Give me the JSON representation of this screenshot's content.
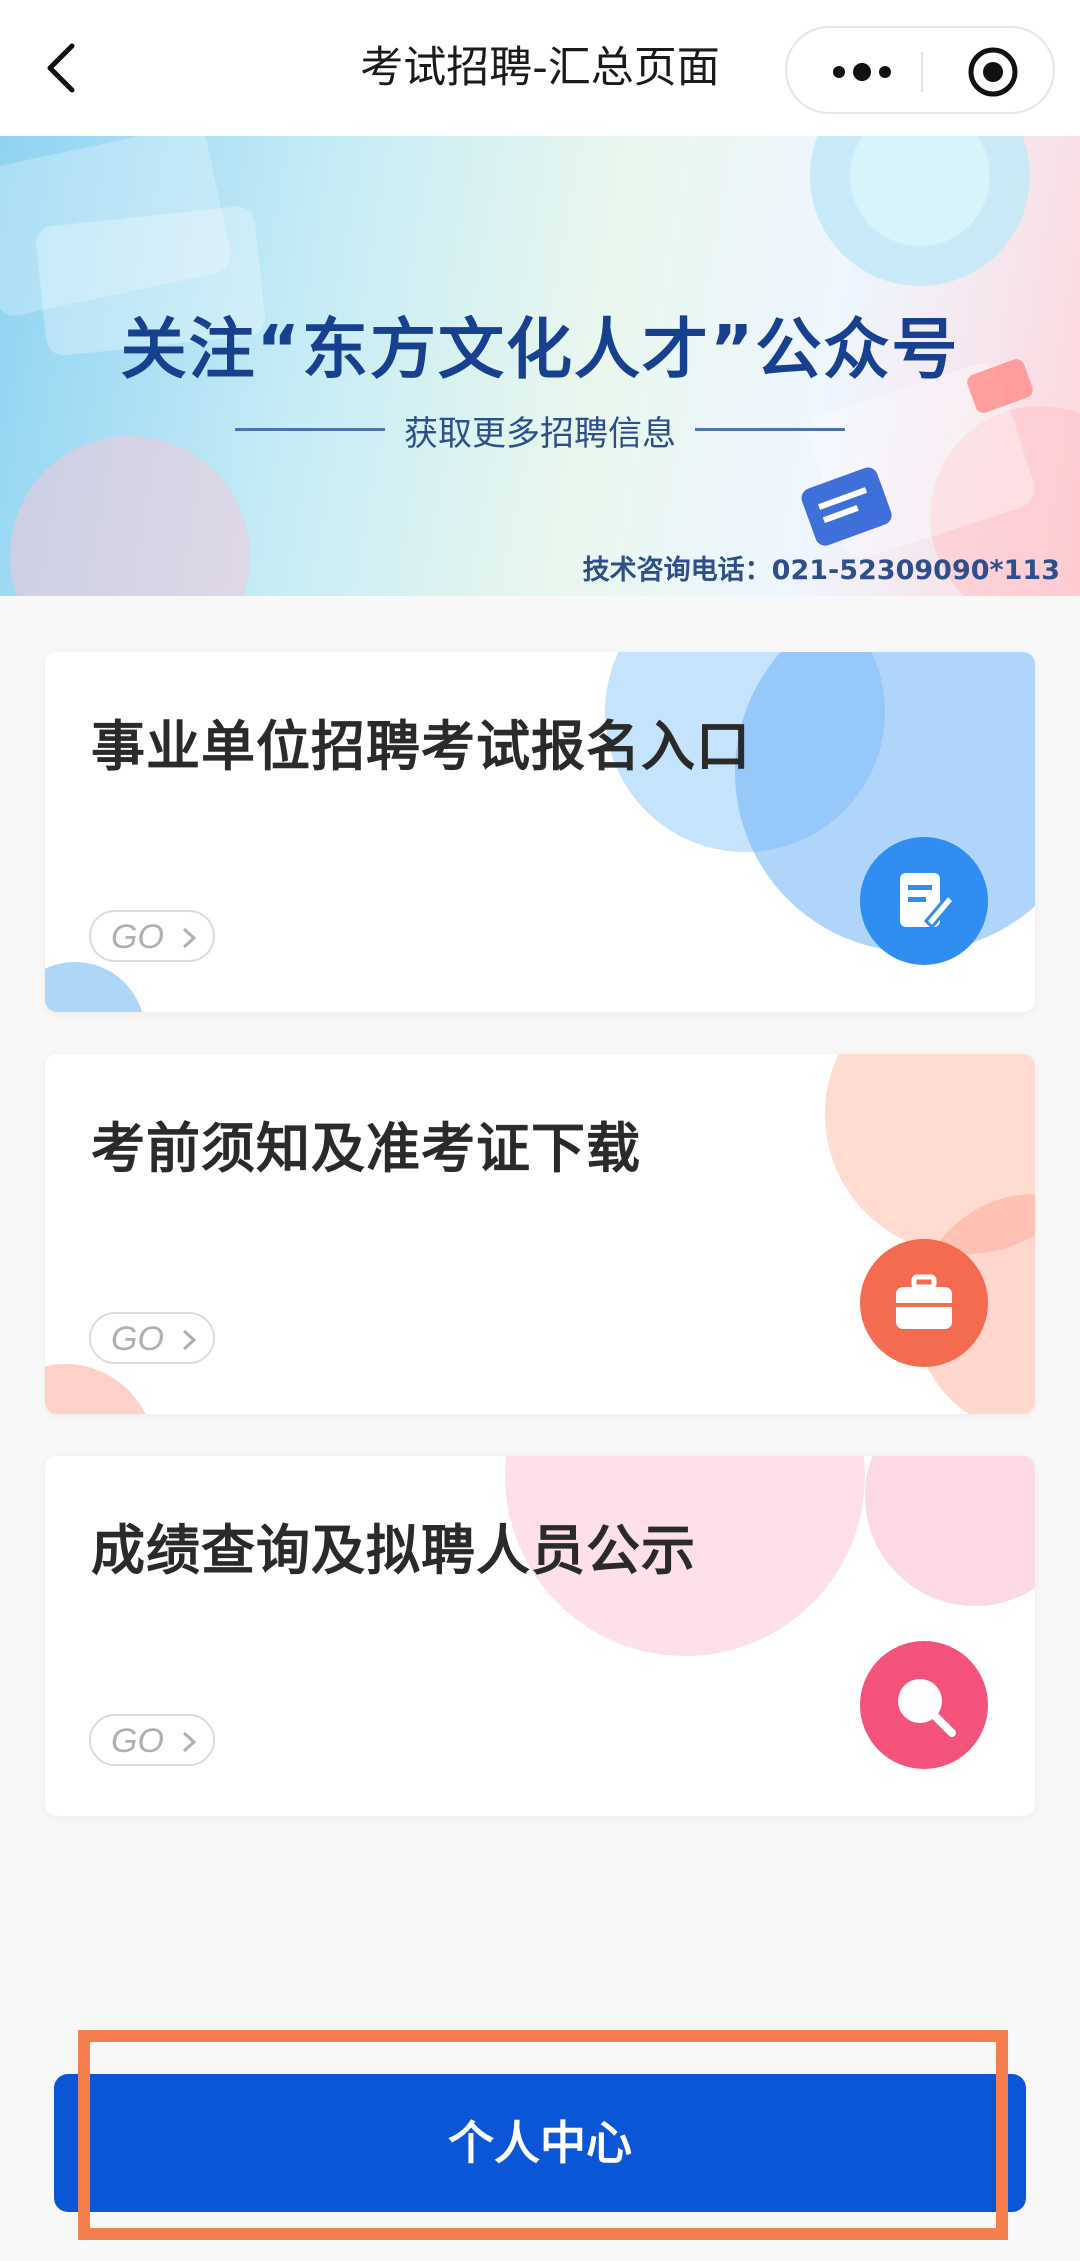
{
  "nav": {
    "title": "考试招聘-汇总页面"
  },
  "banner": {
    "headline": "关注“东方文化人才”公众号",
    "subtitle": "获取更多招聘信息",
    "phone": "技术咨询电话：021-52309090*113"
  },
  "cards": [
    {
      "title": "事业单位招聘考试报名入口",
      "go_label": "GO",
      "icon": "edit-icon",
      "color": "#2f8ef0"
    },
    {
      "title": "考前须知及准考证下载",
      "go_label": "GO",
      "icon": "briefcase-icon",
      "color": "#f46b4f"
    },
    {
      "title": "成绩查询及拟聘人员公示",
      "go_label": "GO",
      "icon": "search-icon",
      "color": "#f3527a"
    }
  ],
  "bottom": {
    "label": "个人中心",
    "color": "#0a56d6",
    "highlight_color": "#f47f4c"
  }
}
